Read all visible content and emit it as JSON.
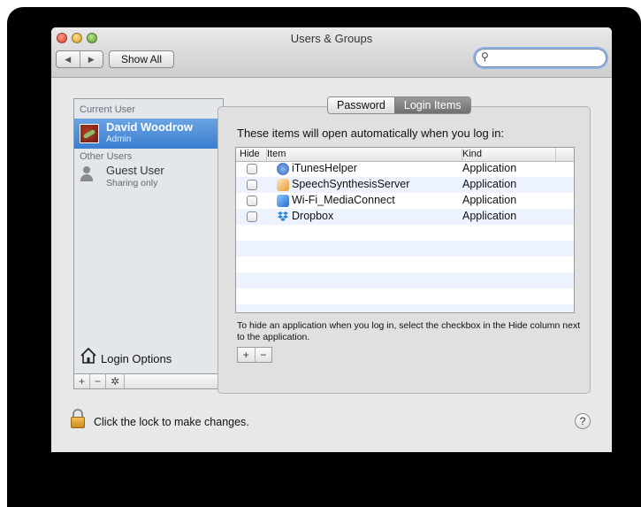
{
  "window": {
    "title": "Users & Groups"
  },
  "toolbar": {
    "back_icon": "left-triangle-icon",
    "forward_icon": "right-triangle-icon",
    "show_all_label": "Show All",
    "search_placeholder": "",
    "search_icon": "magnifier-icon"
  },
  "sidebar": {
    "current_user_heading": "Current User",
    "current_user": {
      "name": "David Woodrow",
      "role": "Admin"
    },
    "other_users_heading": "Other Users",
    "other_users": [
      {
        "name": "Guest User",
        "role": "Sharing only"
      }
    ],
    "login_options_label": "Login Options",
    "add_label": "+",
    "remove_label": "−",
    "action_label": "✲"
  },
  "tabs": [
    {
      "label": "Password"
    },
    {
      "label": "Login Items"
    }
  ],
  "login_items": {
    "intro": "These items will open automatically when you log in:",
    "columns": {
      "hide": "Hide",
      "item": "Item",
      "kind": "Kind"
    },
    "rows": [
      {
        "name": "iTunesHelper",
        "kind": "Application",
        "hidden": false
      },
      {
        "name": "SpeechSynthesisServer",
        "kind": "Application",
        "hidden": false
      },
      {
        "name": "Wi-Fi_MediaConnect",
        "kind": "Application",
        "hidden": false
      },
      {
        "name": "Dropbox",
        "kind": "Application",
        "hidden": false
      }
    ],
    "hint": "To hide an application when you log in, select the checkbox in the Hide column next to the application.",
    "add_label": "+",
    "remove_label": "−"
  },
  "footer": {
    "lock_text": "Click the lock to make changes.",
    "help_label": "?"
  },
  "colors": {
    "selection": "#3a7dd0",
    "table_alt_row": "#edf3fe",
    "active_tab": "#6f6f6f"
  }
}
